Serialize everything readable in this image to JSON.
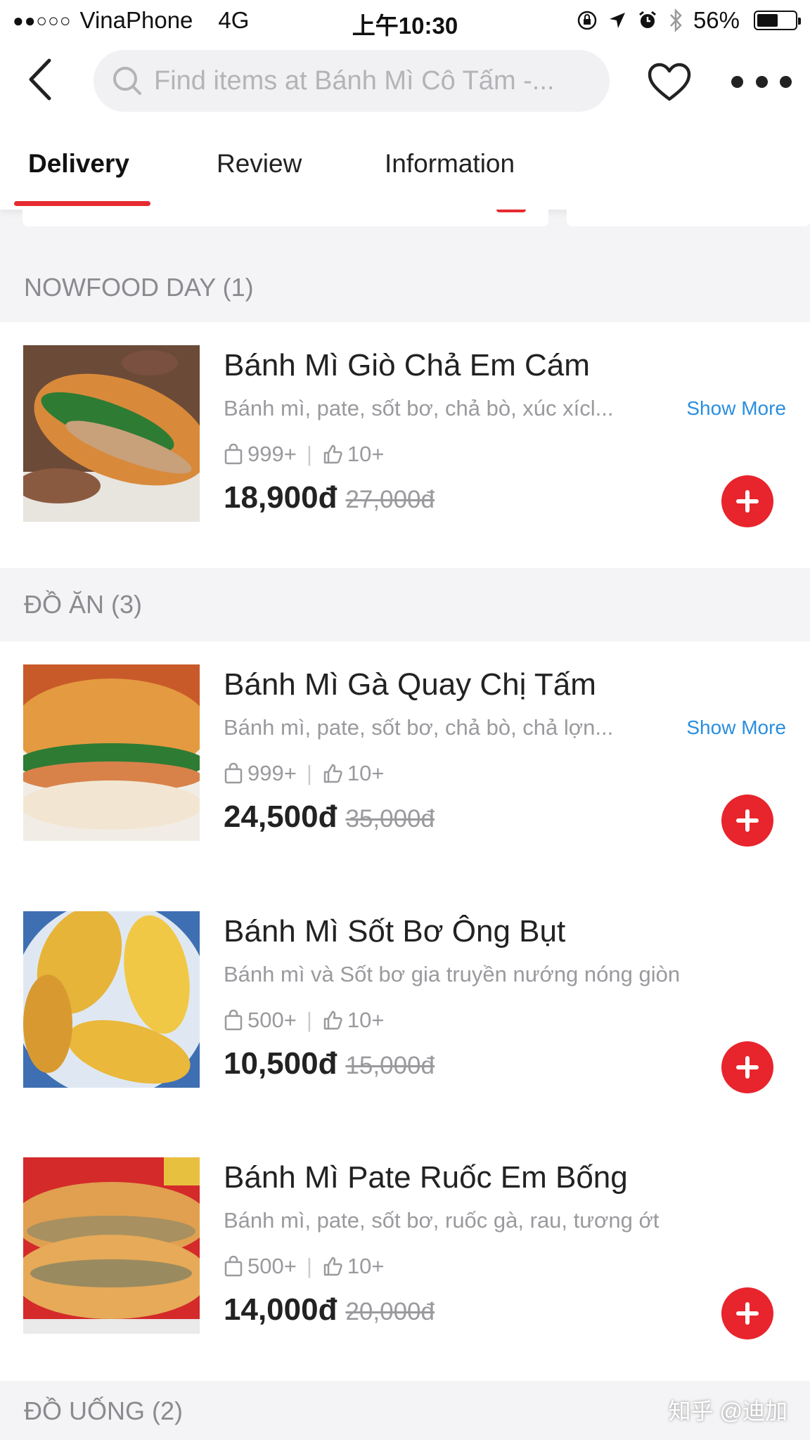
{
  "status_bar": {
    "signal": "●●○○○",
    "carrier": "VinaPhone",
    "network": "4G",
    "time": "上午10:30",
    "battery_percent": "56%",
    "battery_level": 0.56
  },
  "nav": {
    "search_placeholder": "Find items at Bánh Mì Cô Tấm -..."
  },
  "tabs": [
    {
      "label": "Delivery",
      "active": true
    },
    {
      "label": "Review",
      "active": false
    },
    {
      "label": "Information",
      "active": false
    }
  ],
  "sections": [
    {
      "title": "NOWFOOD DAY (1)",
      "items": [
        {
          "name": "Bánh Mì Giò Chả Em Cám",
          "description": "Bánh mì, pate, sốt bơ, chả bò, xúc xícl...",
          "show_more": "Show More",
          "orders": "999+",
          "likes": "10+",
          "price": "18,900đ",
          "old_price": "27,000đ"
        }
      ]
    },
    {
      "title": "ĐỒ ĂN (3)",
      "items": [
        {
          "name": "Bánh Mì Gà Quay Chị Tấm",
          "description": "Bánh mì, pate, sốt bơ, chả bò, chả lợn...",
          "show_more": "Show More",
          "orders": "999+",
          "likes": "10+",
          "price": "24,500đ",
          "old_price": "35,000đ"
        },
        {
          "name": "Bánh Mì Sốt Bơ Ông Bụt",
          "description": "Bánh mì và Sốt bơ gia truyền nướng nóng giòn",
          "orders": "500+",
          "likes": "10+",
          "price": "10,500đ",
          "old_price": "15,000đ"
        },
        {
          "name": "Bánh Mì Pate Ruốc Em Bống",
          "description": "Bánh mì, pate, sốt bơ, ruốc gà, rau, tương ớt",
          "orders": "500+",
          "likes": "10+",
          "price": "14,000đ",
          "old_price": "20,000đ"
        }
      ]
    },
    {
      "title": "ĐỒ UỐNG (2)",
      "items": []
    }
  ],
  "watermark": "知乎 @迪加",
  "colors": {
    "accent_red": "#e8242c",
    "link_blue": "#2a8ee0",
    "muted_text": "#9a9a9e"
  }
}
